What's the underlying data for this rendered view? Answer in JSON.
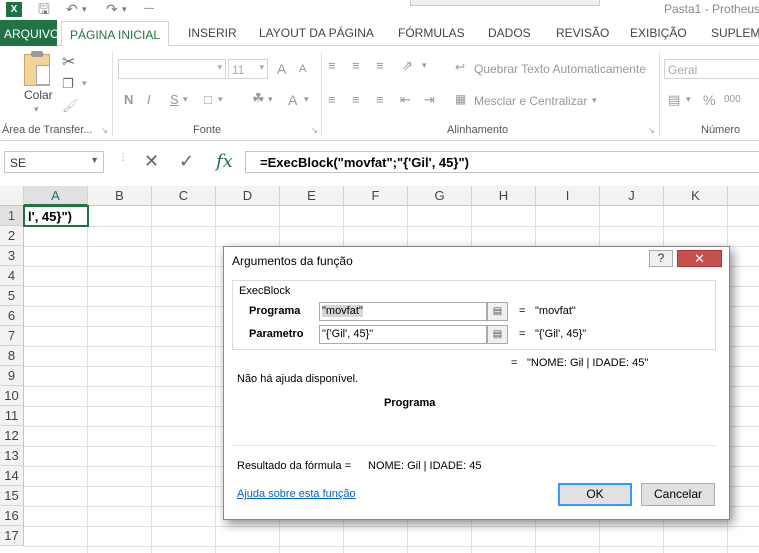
{
  "titlebar": {
    "app_icon": "X",
    "title": "Pasta1 - Protheus"
  },
  "tabs": {
    "file": "ARQUIVO",
    "items": [
      "PÁGINA INICIAL",
      "INSERIR",
      "LAYOUT DA PÁGINA",
      "FÓRMULAS",
      "DADOS",
      "REVISÃO",
      "EXIBIÇÃO",
      "SUPLEME"
    ]
  },
  "ribbon": {
    "paste_label": "Colar",
    "font_size": "11",
    "wrap_text": "Quebrar Texto Automaticamente",
    "merge_center": "Mesclar e Centralizar",
    "number_format": "Geral",
    "percent": "%",
    "thousands": "000",
    "bold": "N",
    "italic": "I",
    "underline": "S",
    "grow_font": "A",
    "shrink_font": "A",
    "font_color": "A",
    "groups": {
      "clipboard": "Área de Transfer...",
      "font": "Fonte",
      "alignment": "Alinhamento",
      "number": "Número"
    }
  },
  "formula_bar": {
    "name_box": "SE",
    "formula": "=ExecBlock(\"movfat\";\"{'Gil', 45}\")"
  },
  "grid": {
    "columns": [
      "A",
      "B",
      "C",
      "D",
      "E",
      "F",
      "G",
      "H",
      "I",
      "J",
      "K"
    ],
    "rows": [
      "1",
      "2",
      "3",
      "4",
      "5",
      "6",
      "7",
      "8",
      "9",
      "10",
      "11",
      "12",
      "13",
      "14",
      "15",
      "16",
      "17"
    ],
    "active_cell_text": "l', 45}\")"
  },
  "dialog": {
    "title": "Argumentos da função",
    "help": "?",
    "close": "✕",
    "function_name": "ExecBlock",
    "args": [
      {
        "label": "Programa",
        "value": "\"movfat\"",
        "result": "\"movfat\""
      },
      {
        "label": "Parametro",
        "value": "\"{'Gil', 45}\"",
        "result": "\"{'Gil', 45}\""
      }
    ],
    "eq": "=",
    "function_result": "\"NOME: Gil | IDADE: 45\"",
    "no_help": "Não há ajuda disponível.",
    "arg_focus": "Programa",
    "formula_result_label": "Resultado da fórmula =",
    "formula_result_value": "NOME: Gil | IDADE: 45",
    "help_link": "Ajuda sobre esta função",
    "ok": "OK",
    "cancel": "Cancelar"
  },
  "colors": {
    "excel_green": "#217346",
    "close_red": "#c75050",
    "link_blue": "#0563c1"
  }
}
